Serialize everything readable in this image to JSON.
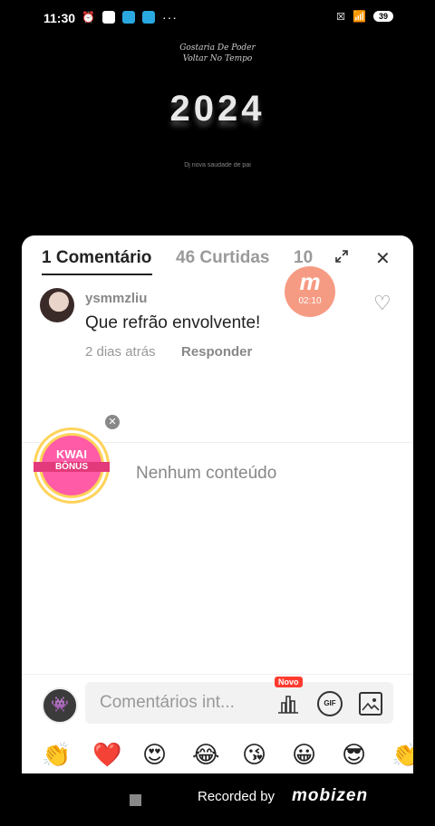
{
  "status_bar": {
    "time": "11:30",
    "more": "···",
    "battery": "39"
  },
  "video": {
    "line1": "Gostaria De Poder",
    "line2": "Voltar No Tempo",
    "year": "2024",
    "tiny": "Dj nova saudade de pai"
  },
  "panel": {
    "tabs": [
      {
        "label": "1 Comentário"
      },
      {
        "label": "46 Curtidas"
      },
      {
        "label": "10"
      }
    ],
    "recorder": {
      "letter": "m",
      "time": "02:10"
    },
    "comment": {
      "username": "ysmmzliu",
      "text": "Que refrão envolvente!",
      "time": "2 dias atrás",
      "reply": "Responder"
    },
    "kwai": {
      "line1": "KWAI",
      "line2": "BÔNUS"
    },
    "empty_text": "Nenhum conteúdo",
    "input": {
      "placeholder": "Comentários int...",
      "new_badge": "Novo"
    },
    "emojis": [
      "👏",
      "❤️",
      "😍",
      "😂",
      "😘",
      "😀",
      "😎",
      "👏"
    ]
  },
  "footer": {
    "recorded": "Recorded by",
    "brand": "mobizen"
  }
}
